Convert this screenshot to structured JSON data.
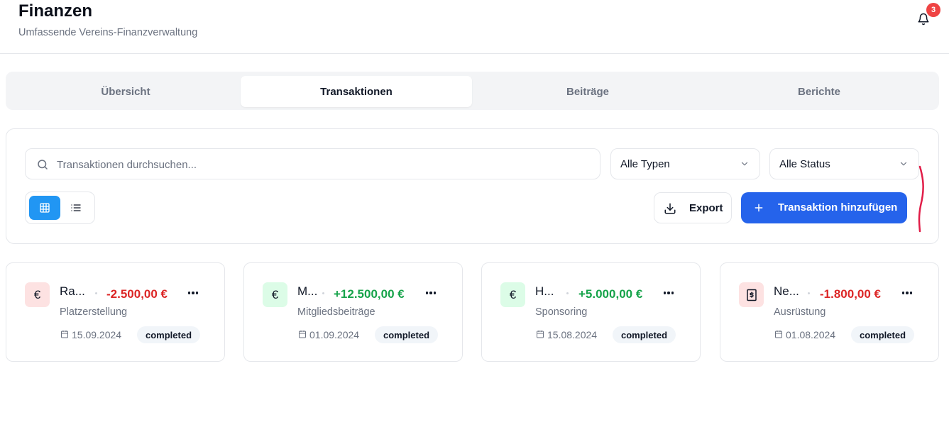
{
  "header": {
    "title": "Finanzen",
    "subtitle": "Umfassende Vereins-Finanzverwaltung",
    "notification_count": "3",
    "notification_icon": "bell-icon"
  },
  "tabs": [
    {
      "label": "Übersicht",
      "active": false
    },
    {
      "label": "Transaktionen",
      "active": true
    },
    {
      "label": "Beiträge",
      "active": false
    },
    {
      "label": "Berichte",
      "active": false
    }
  ],
  "filters": {
    "search_placeholder": "Transaktionen durchsuchen...",
    "search_value": "",
    "type_select": "Alle Typen",
    "status_select": "Alle Status",
    "view_mode": "grid"
  },
  "actions": {
    "export_label": "Export",
    "add_label": "Transaktion hinzufügen"
  },
  "colors": {
    "accent": "#2563eb",
    "toggle_active": "#2196f3",
    "expense": "#dc2626",
    "income": "#16a34a",
    "expense_bg": "#fde2e2",
    "income_bg": "#dcfce7",
    "annotation": "#e11d48"
  },
  "transactions": [
    {
      "name": "Ra...",
      "amount": "-2.500,00 €",
      "kind": "expense",
      "icon": "euro-icon",
      "category": "Platzerstellung",
      "date": "15.09.2024",
      "status": "completed"
    },
    {
      "name": "M...",
      "amount": "+12.500,00 €",
      "kind": "income",
      "icon": "euro-icon",
      "category": "Mitgliedsbeiträge",
      "date": "01.09.2024",
      "status": "completed"
    },
    {
      "name": "H...",
      "amount": "+5.000,00 €",
      "kind": "income",
      "icon": "euro-icon",
      "category": "Sponsoring",
      "date": "15.08.2024",
      "status": "completed"
    },
    {
      "name": "Ne...",
      "amount": "-1.800,00 €",
      "kind": "expense",
      "icon": "receipt-icon",
      "category": "Ausrüstung",
      "date": "01.08.2024",
      "status": "completed"
    }
  ]
}
